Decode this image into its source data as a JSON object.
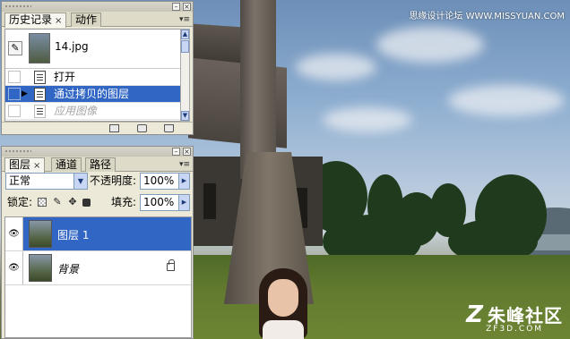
{
  "watermark_top": "思缘设计论坛 WWW.MISSYUAN.COM",
  "brand": {
    "main": "朱峰社区",
    "sub": "ZF3D.COM",
    "mark": "Z"
  },
  "history_panel": {
    "tabs": [
      {
        "label": "历史记录",
        "active": true
      },
      {
        "label": "动作",
        "active": false
      }
    ],
    "snapshot_name": "14.jpg",
    "steps": [
      {
        "label": "打开",
        "state": "normal"
      },
      {
        "label": "通过拷贝的图层",
        "state": "selected"
      },
      {
        "label": "应用图像",
        "state": "dimmed"
      }
    ]
  },
  "layers_panel": {
    "tabs": [
      {
        "label": "图层",
        "active": true
      },
      {
        "label": "通道",
        "active": false
      },
      {
        "label": "路径",
        "active": false
      }
    ],
    "blend_mode": "正常",
    "opacity_label": "不透明度:",
    "opacity_value": "100%",
    "lock_label": "锁定:",
    "fill_label": "填充:",
    "fill_value": "100%",
    "layers": [
      {
        "name": "图层 1",
        "selected": true,
        "visible": true,
        "locked": false
      },
      {
        "name": "背景",
        "selected": false,
        "visible": true,
        "locked": true
      }
    ]
  },
  "colors": {
    "selection": "#3166c4",
    "panel_bg": "#ece9d8"
  }
}
